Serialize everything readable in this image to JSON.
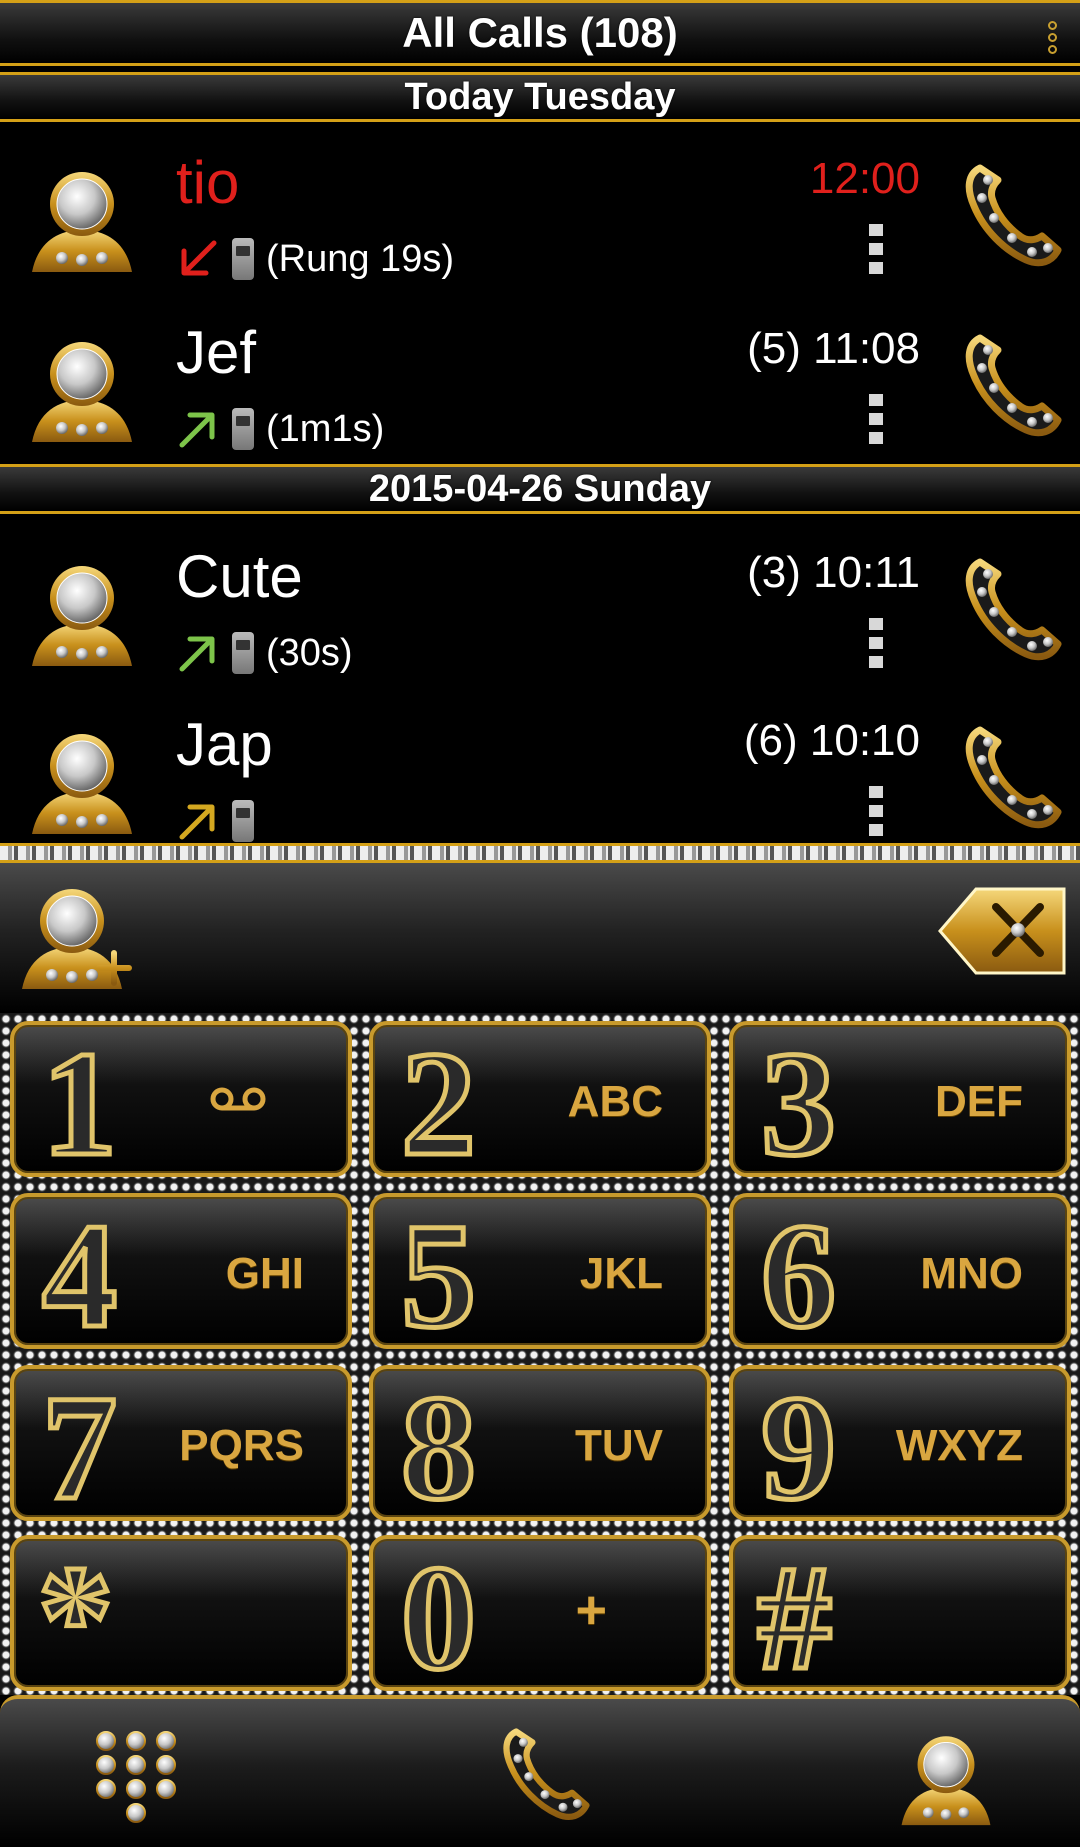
{
  "header": {
    "title": "All Calls (108)"
  },
  "sections": [
    {
      "label": "Today  Tuesday"
    },
    {
      "label": "2015-04-26  Sunday"
    }
  ],
  "calls": [
    {
      "name": "tio",
      "time": "12:00",
      "duration": "(Rung 19s)",
      "type": "missed",
      "name_color": "#e0201c",
      "arrow_color": "#e0201c"
    },
    {
      "name": "Jef",
      "time": "(5) 11:08",
      "duration": "(1m1s)",
      "type": "outgoing",
      "name_color": "#ffffff",
      "arrow_color": "#7dc44a"
    },
    {
      "name": "Cute",
      "time": "(3) 10:11",
      "duration": "(30s)",
      "type": "outgoing",
      "name_color": "#ffffff",
      "arrow_color": "#7dc44a"
    },
    {
      "name": "Jap",
      "time": "(6) 10:10",
      "duration": "",
      "type": "outgoing",
      "name_color": "#ffffff",
      "arrow_color": "#d4a820"
    }
  ],
  "keypad": [
    {
      "digit": "1",
      "letters": ""
    },
    {
      "digit": "2",
      "letters": "ABC"
    },
    {
      "digit": "3",
      "letters": "DEF"
    },
    {
      "digit": "4",
      "letters": "GHI"
    },
    {
      "digit": "5",
      "letters": "JKL"
    },
    {
      "digit": "6",
      "letters": "MNO"
    },
    {
      "digit": "7",
      "letters": "PQRS"
    },
    {
      "digit": "8",
      "letters": "TUV"
    },
    {
      "digit": "9",
      "letters": "WXYZ"
    },
    {
      "digit": "*",
      "letters": ""
    },
    {
      "digit": "0",
      "letters": "+"
    },
    {
      "digit": "#",
      "letters": ""
    }
  ],
  "icons": {
    "menu": "overflow-menu-icon",
    "add_contact": "add-contact-icon",
    "backspace": "backspace-icon",
    "voicemail": "voicemail-icon",
    "dialpad": "dialpad-icon",
    "call": "phone-icon",
    "contacts": "contacts-icon"
  },
  "colors": {
    "gold": "#d4a017",
    "missed": "#e0201c",
    "outgoing": "#7dc44a"
  }
}
